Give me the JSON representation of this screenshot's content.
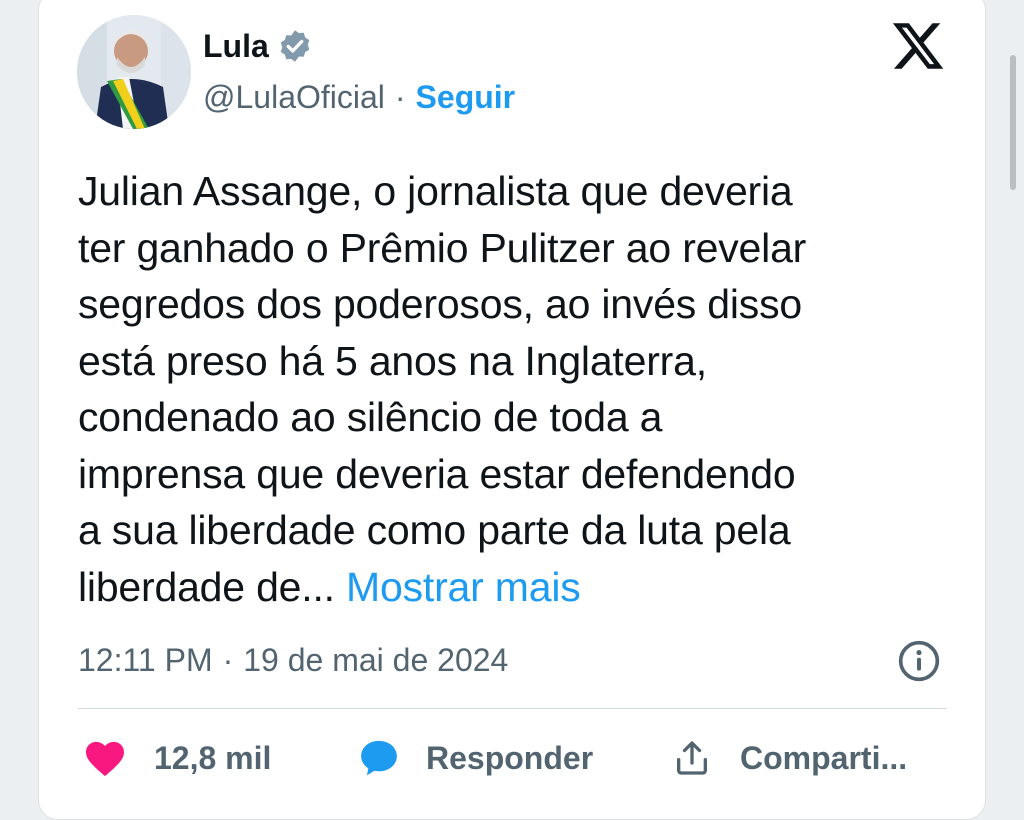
{
  "author": {
    "name": "Lula",
    "handle": "@LulaOficial",
    "separator": "·",
    "follow_label": "Seguir"
  },
  "tweet": {
    "lines": [
      "Julian Assange, o jornalista que deveria",
      "ter ganhado o Prêmio Pulitzer ao revelar",
      "segredos dos poderosos, ao invés disso",
      "está preso há 5 anos na Inglaterra,",
      "condenado ao silêncio de toda a",
      "imprensa que deveria estar defendendo",
      "a sua liberdade como parte da luta pela",
      "liberdade de... "
    ],
    "show_more_label": "Mostrar mais"
  },
  "meta": {
    "time": "12:11 PM",
    "separator": "·",
    "date": "19 de mai de 2024"
  },
  "actions": {
    "likes": "12,8 mil",
    "reply_label": "Responder",
    "share_label": "Comparti..."
  },
  "icons": {
    "verified": "verified-badge-icon",
    "platform": "x-logo-icon",
    "info": "info-icon",
    "like": "heart-icon",
    "reply": "speech-bubble-icon",
    "share": "share-icon"
  },
  "colors": {
    "accent": "#1d9bf0",
    "like": "#f91880",
    "text": "#0f1419",
    "muted": "#536471",
    "verified": "#829aab"
  }
}
